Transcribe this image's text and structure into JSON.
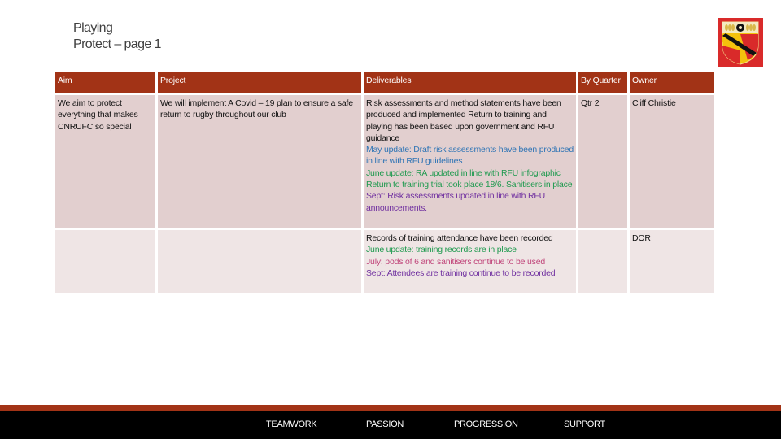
{
  "title": {
    "line1": "Playing",
    "line2": "Protect – page 1"
  },
  "logo": {
    "name": "club-crest",
    "colors": {
      "red": "#d92a2a",
      "yellow": "#f4c20d",
      "black": "#111111"
    }
  },
  "table": {
    "headers": {
      "aim": "Aim",
      "project": "Project",
      "deliverables": "Deliverables",
      "by_quarter": "By Quarter",
      "owner": "Owner"
    },
    "rows": [
      {
        "aim": "We aim to protect everything that makes CNRUFC so special",
        "project": "We will implement A Covid  – 19 plan to ensure a safe return to rugby throughout our club",
        "deliverables": [
          {
            "text": "Risk assessments and method statements  have been produced and implemented  Return to training and playing has been based upon government and RFU guidance",
            "color": "#111111"
          },
          {
            "text": "May update: Draft risk assessments have been produced in line with RFU guidelines",
            "color": "#2e74b5"
          },
          {
            "text": "June update: RA updated in line with RFU infographic  Return to training trial took place 18/6. Sanitisers in place",
            "color": "#1f9a4f"
          },
          {
            "text": "Sept: Risk assessments updated in line with RFU announcements.",
            "color": "#7030a0"
          }
        ],
        "by_quarter": "Qtr 2",
        "owner": "Cliff Christie"
      },
      {
        "aim": "",
        "project": "",
        "deliverables": [
          {
            "text": "Records of training attendance have been recorded",
            "color": "#111111"
          },
          {
            "text": "June update: training records are in place",
            "color": "#1f9a4f"
          },
          {
            "text": "July: pods of 6  and sanitisers continue to be used",
            "color": "#c0457a"
          },
          {
            "text": "Sept: Attendees are training continue to be recorded",
            "color": "#7030a0"
          }
        ],
        "by_quarter": "",
        "owner": "DOR"
      }
    ]
  },
  "footer": {
    "values": [
      "TEAMWORK",
      "PASSION",
      "PROGRESSION",
      "SUPPORT"
    ]
  },
  "colors": {
    "accent": "#a23316",
    "row1_bg": "#e2cfcf",
    "row2_bg": "#efe5e5",
    "footer_bg": "#000000"
  }
}
